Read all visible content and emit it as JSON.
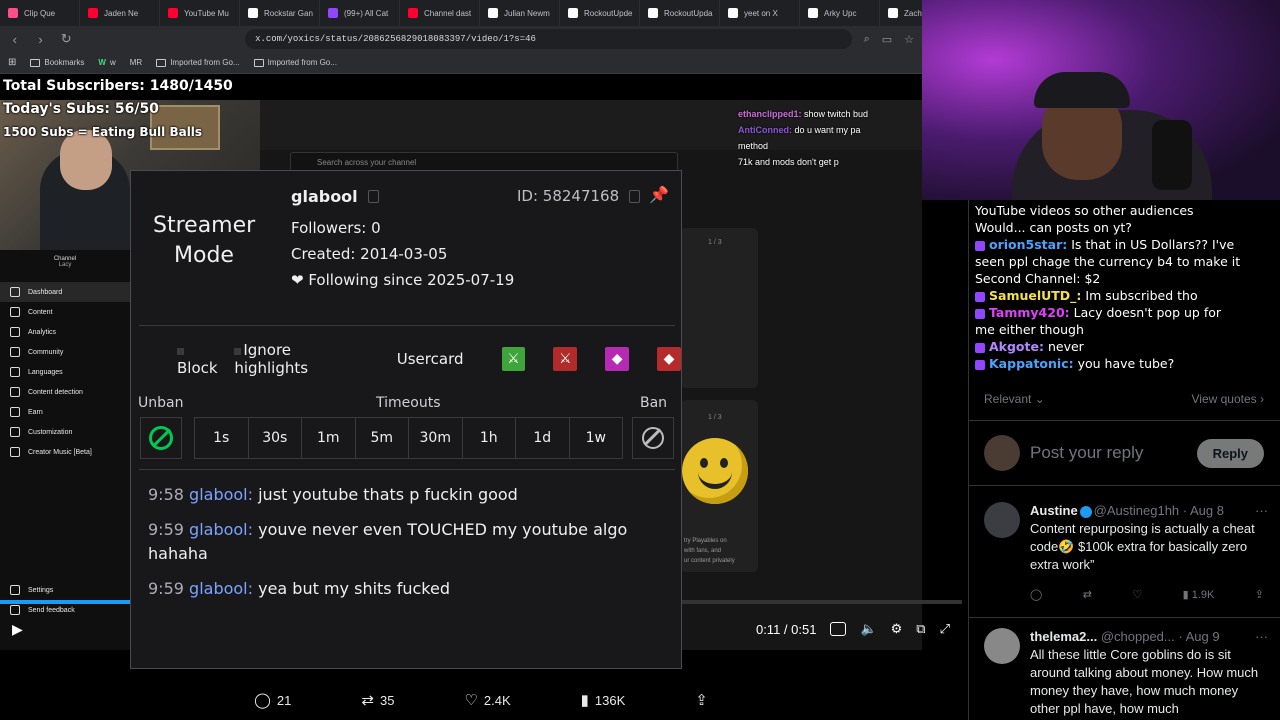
{
  "browser": {
    "tabs": [
      {
        "label": "Clip Que",
        "color": "#ff4f8b"
      },
      {
        "label": "Jaden Ne",
        "color": "#ff0033"
      },
      {
        "label": "YouTube Mu",
        "color": "#ff0033"
      },
      {
        "label": "Rockstar Gan",
        "color": "#ffffff"
      },
      {
        "label": "(99+) All Cat",
        "color": "#9146ff"
      },
      {
        "label": "Channel dast",
        "color": "#ff0033"
      },
      {
        "label": "Julian Newm",
        "color": "#ffffff"
      },
      {
        "label": "RockoutUpde",
        "color": "#ffffff"
      },
      {
        "label": "RockoutUpda",
        "color": "#ffffff"
      },
      {
        "label": "yeet on X",
        "color": "#ffffff"
      },
      {
        "label": "Arky Upc",
        "color": "#ffffff"
      },
      {
        "label": "Zach",
        "color": "#ffffff"
      }
    ],
    "url": "x.com/yoxics/status/2086256829018083397/video/1?s=46",
    "bookmarks": [
      "Bookmarks",
      "w",
      "MR",
      "Imported from Go...",
      "Imported from Go..."
    ]
  },
  "overlay": {
    "total_subs": "Total Subscribers: 1480/1450",
    "today_subs": "Today's Subs: 56/50",
    "goal": "1500 Subs = Eating Bull Balls"
  },
  "twitch_overlay": {
    "lines": [
      {
        "user": "ethanclipped1:",
        "text": " show twitch bud"
      },
      {
        "user": "AntiConned:",
        "text": " do u want my pa"
      },
      {
        "user": "",
        "text": "method"
      },
      {
        "user": "",
        "text": "71k and mods don't get p"
      }
    ]
  },
  "studio": {
    "channel_label": "Channel",
    "channel_name": "Lacy",
    "search_placeholder": "Search across your channel",
    "nav": [
      "Dashboard",
      "Content",
      "Analytics",
      "Community",
      "Languages",
      "Content detection",
      "Earn",
      "Customization",
      "Creator Music [Beta]"
    ],
    "footer": [
      "Settings",
      "Send feedback"
    ],
    "page1": "1 / 3",
    "page2": "1 / 3",
    "card_text": [
      "try Playables on",
      "with fans, and",
      "ur content privately"
    ]
  },
  "modal": {
    "title": "Streamer Mode",
    "username": "glabool",
    "id": "ID: 58247168",
    "followers": "Followers: 0",
    "created": "Created: 2014-03-05",
    "following": "❤ Following since 2025-07-19",
    "block": "Block",
    "ignore": "Ignore highlights",
    "usercard": "Usercard",
    "unban_label": "Unban",
    "timeouts_label": "Timeouts",
    "ban_label": "Ban",
    "timeouts": [
      "1s",
      "30s",
      "1m",
      "5m",
      "30m",
      "1h",
      "1d",
      "1w"
    ],
    "messages": [
      {
        "time": "9:58",
        "user": "glabool:",
        "text": " just youtube thats p fuckin good"
      },
      {
        "time": "9:59",
        "user": "glabool:",
        "text": " youve never even TOUCHED my youtube algo hahaha"
      },
      {
        "time": "9:59",
        "user": "glabool:",
        "text": " yea but my shits fucked"
      }
    ]
  },
  "x_overlay": {
    "lines": [
      {
        "user": "",
        "text": "YouTube videos so other audiences"
      },
      {
        "user": "",
        "text": "Would... can posts on yt?"
      },
      {
        "user": "orion5star:",
        "text": " Is that in US Dollars?? I've"
      },
      {
        "user": "",
        "text": "seen ppl chage the currency b4 to make it"
      },
      {
        "user": "",
        "text": "Second Channel: $2"
      },
      {
        "user": "SamuelUTD_:",
        "text": " Im subscribed tho"
      },
      {
        "user": "Tammy420:",
        "text": " Lacy doesn't pop up for"
      },
      {
        "user": "",
        "text": "me either though"
      },
      {
        "user": "Akgote:",
        "text": " never"
      },
      {
        "user": "Kappatonic:",
        "text": " you have tube?"
      }
    ]
  },
  "x": {
    "relevant": "Relevant",
    "view_quotes": "View quotes",
    "reply_placeholder": "Post your reply",
    "reply_button": "Reply",
    "tweets": [
      {
        "name": "Austine",
        "handle": "@Austineg1hh · Aug 8",
        "text": "Content repurposing is actually a cheat code🤣 $100k extra for basically zero extra work”",
        "views": "1.9K"
      },
      {
        "name": "thelema2...",
        "handle": "@chopped... · Aug 9",
        "text": "All these little Core goblins do is sit around talking about money. How much money they have, how much money other ppl have, how much"
      }
    ]
  },
  "video": {
    "time": "0:11 / 0:51",
    "progress": 0.216,
    "replies": "21",
    "reposts": "35",
    "likes": "2.4K",
    "views": "136K"
  }
}
